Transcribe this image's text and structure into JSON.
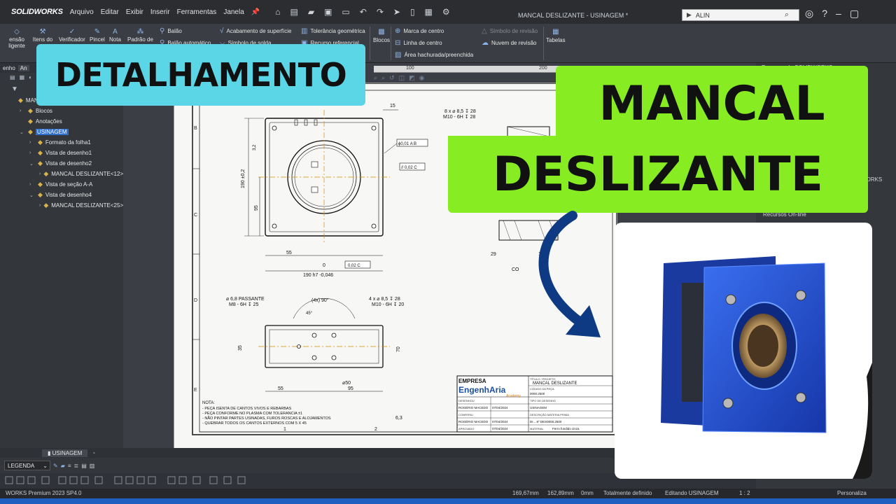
{
  "app": {
    "logo": "SOLIDWORKS",
    "menus": [
      "Arquivo",
      "Editar",
      "Exibir",
      "Inserir",
      "Ferramentas",
      "Janela"
    ],
    "window_title": "MANCAL DESLIZANTE - USINAGEM *",
    "search_value": "ALIN"
  },
  "ribbon": {
    "items": {
      "nota_inteligente": "ensão\nligente",
      "itens_modelo": "Itens do\nm",
      "verificador": "Verificador",
      "pincel": "Pincel",
      "nota": "Nota",
      "padrao": "Padrão de",
      "balao": "Balão",
      "balao_auto": "Balão automático",
      "acabamento": "Acabamento de superfície",
      "simbolo_solda": "Símbolo de solda",
      "tolerancia": "Tolerância geométrica",
      "recurso_ref": "Recurso referencial",
      "blocos": "Blocos",
      "marca_centro": "Marca de centro",
      "linha_centro": "Linha de centro",
      "area_hachurada": "Área hachurada/preenchida",
      "simbolo_revisao": "Símbolo de revisão",
      "nuvem_revisao": "Nuvem de revisão",
      "tabelas": "Tabelas"
    }
  },
  "tabs_row": [
    "enho",
    "An"
  ],
  "tree": [
    {
      "label": "MANCAL DESLIZANTE",
      "indent": 0,
      "expander": ""
    },
    {
      "label": "Blocos",
      "indent": 1,
      "expander": "›"
    },
    {
      "label": "Anotações",
      "indent": 1,
      "expander": ""
    },
    {
      "label": "USINAGEM",
      "indent": 1,
      "expander": "⌄",
      "selected": true
    },
    {
      "label": "Formato da folha1",
      "indent": 2,
      "expander": "›"
    },
    {
      "label": "Vista de desenho1",
      "indent": 2,
      "expander": "›"
    },
    {
      "label": "Vista de desenho2",
      "indent": 2,
      "expander": "⌄"
    },
    {
      "label": "MANCAL DESLIZANTE<12>",
      "indent": 3,
      "expander": "›"
    },
    {
      "label": "Vista de seção A-A",
      "indent": 2,
      "expander": "›"
    },
    {
      "label": "Vista de desenho4",
      "indent": 2,
      "expander": "⌄"
    },
    {
      "label": "MANCAL DESLIZANTE<25>",
      "indent": 3,
      "expander": "›"
    }
  ],
  "drawing": {
    "ruler": [
      "100",
      "200",
      "300"
    ],
    "border_letters": [
      "A",
      "B",
      "C",
      "D",
      "E"
    ],
    "border_numbers": [
      "1",
      "2",
      "3",
      "4"
    ],
    "dims": {
      "d15": "15",
      "d3_2": "3,2",
      "d190": "190 ±0,2",
      "d95": "95",
      "d55": "55",
      "d0": "0",
      "d190h7": "190 h7 -0,046",
      "d0_02c": "0,02 C",
      "d_phi": "ϕ0,01 A B",
      "d_par": "// 0,02 C",
      "d8x": "8 x ⌀ 8,5 ↧ 28",
      "d_m10": "M10 - 6H ↧ 28",
      "d29": "29",
      "d12": "12",
      "d68": "⌀ 6,8 PASSANTE",
      "d_m8": "M8 - 6H ↧ 25",
      "d4x90": "(4x) 90°",
      "d45": "45°",
      "d4x": "4 x ⌀ 8,5 ↧ 28",
      "d_m10b": "M10 - 6H ↧ 20",
      "d35": "35",
      "d70": "70",
      "d50": "⌀50",
      "d55b": "55",
      "d95b": "95",
      "d63": "6,3",
      "co": "CO"
    },
    "notes": {
      "title": "NOTA:",
      "lines": [
        "- PEÇA ISENTA DE CANTOS VIVOS E REBARBAS",
        "- PEÇA CONFORME NO PLASMA COM TOLERANCIA ±1",
        "- NÃO PINTAR PARTES USINADAS, FUROS ROSCAS E ALOJAMENTOS",
        "- QUEBRAR TODOS OS CANTOS EXTERNOS COM 5 X 45"
      ]
    },
    "titleblock": {
      "empresa": "EMPRESA",
      "brand": "EngenhAria",
      "brand_sub": "Academy",
      "projeto_label": "TÍTULO / PROJETO",
      "projeto": "MANCAL DESLIZANTE",
      "codigo_label": "CÓDIGO DA PEÇA",
      "codigo": "0000.2500",
      "desenhou_label": "DESENHOU",
      "desenhou": "ROGÉRIO MACEDO",
      "data1": "07/04/2024",
      "conferiu_label": "CONFERIU",
      "conferiu": "ROGÉRIO MACEDO",
      "data2": "07/04/2024",
      "aprovado_label": "APROVADO",
      "aprovado": "ROGÉRIO MACEDO",
      "data3": "07/04/2024",
      "tipo_label": "TIPO DE DESENHO",
      "tipo": "USINAGEM",
      "descricao_label": "DESCRIÇÃO MATERIA PRIMA",
      "descricao": "DI... 8\" DES0000.2500",
      "material_label": "MATERIAL",
      "material": "Ferro fundido cinza"
    }
  },
  "bottom": {
    "sheet_tab": "USINAGEM",
    "layer": "LEGENDA",
    "status": {
      "version": "WORKS Premium 2023 SP4.0",
      "x": "169,67mm",
      "y": "162,89mm",
      "z": "0mm",
      "defined": "Totalmente definido",
      "editing": "Editando USINAGEM",
      "scale": "1 : 2",
      "custom": "Personaliza"
    }
  },
  "rightpane": {
    "header": "Recursos do SOLIDWORKS",
    "works": "WORKS",
    "online": "Recursos On-line"
  },
  "overlays": {
    "detalhamento": "DETALHAMENTO",
    "mancal": "MANCAL",
    "deslizante": "DESLIZANTE"
  },
  "colors": {
    "cyan_label": "#5ad6e6",
    "green_label": "#88ec22",
    "model_blue": "#1f4fd6",
    "arrow": "#0d3a82"
  }
}
